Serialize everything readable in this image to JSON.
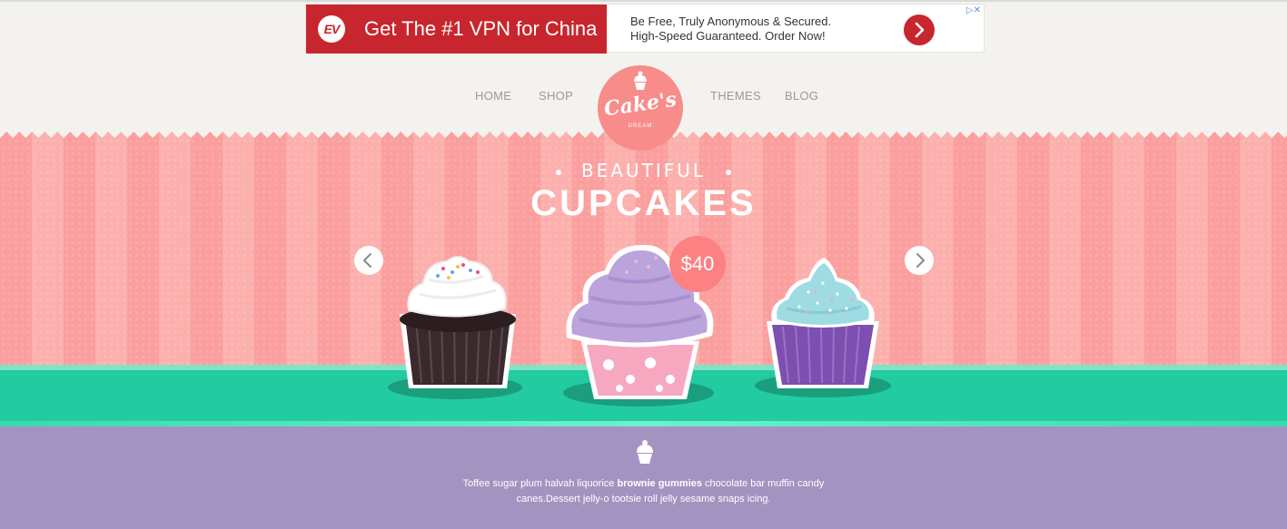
{
  "ad": {
    "headline": "Get The #1 VPN for China",
    "logo_text": "EV",
    "line1": "Be Free, Truly Anonymous & Secured.",
    "line2": "High-Speed Guaranteed. Order Now!",
    "choices": "▷✕",
    "brand_color": "#c8262e",
    "icons": [
      "expressvpn-logo-icon",
      "chevron-right-icon"
    ]
  },
  "nav": {
    "items": [
      "HOME",
      "SHOP",
      "THEMES",
      "BLOG"
    ],
    "logo_text": "Cake's",
    "logo_sub": "DREAM"
  },
  "hero": {
    "subtitle": "BEAUTIFUL",
    "title": "CUPCAKES",
    "price": "$40",
    "colors": {
      "stripe_a": "#fa9f9e",
      "stripe_b": "#fcb0ad",
      "table": "#22cba0",
      "badge": "#fb8183"
    },
    "icons": [
      "chevron-left-icon",
      "chevron-right-icon"
    ]
  },
  "about": {
    "text_before": "Toffee sugar plum halvah liquorice ",
    "text_bold": "brownie gummies",
    "text_after": " chocolate bar muffin candy canes.Dessert jelly-o tootsie roll jelly sesame snaps icing.",
    "background": "#a393c1",
    "icon": "cupcake-icon"
  }
}
